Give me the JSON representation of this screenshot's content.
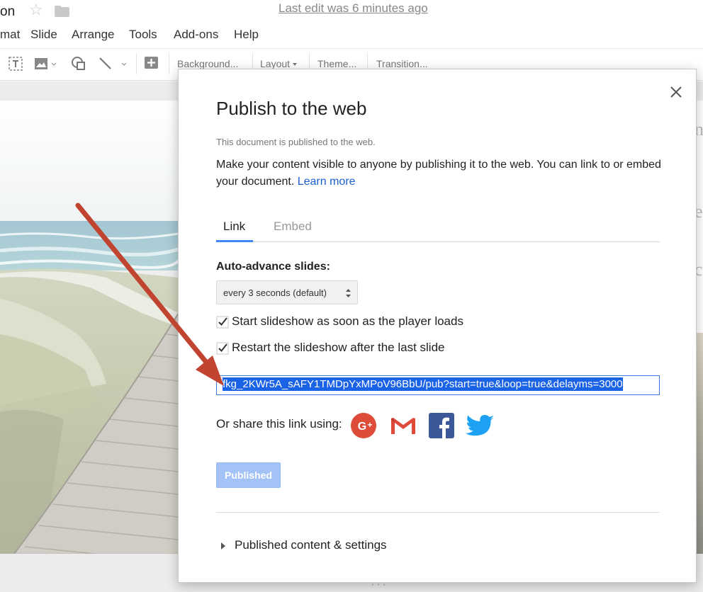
{
  "app": {
    "doc_title_fragment": "on",
    "menu": [
      "mat",
      "Slide",
      "Arrange",
      "Tools",
      "Add-ons",
      "Help"
    ],
    "last_edit": "Last edit was 6 minutes ago",
    "toolbar": {
      "background": "Background...",
      "layout": "Layout",
      "theme": "Theme...",
      "transition": "Transition..."
    },
    "icons": [
      "star-icon",
      "folder-icon",
      "text-box-icon",
      "image-icon",
      "shape-icon",
      "line-icon",
      "new-slide-icon"
    ]
  },
  "dialog": {
    "title": "Publish to the web",
    "status": "This document is published to the web.",
    "description": "Make your content visible to anyone by publishing it to the web. You can link to or embed your document.",
    "learn_more": "Learn more",
    "tabs": [
      {
        "label": "Link",
        "active": true
      },
      {
        "label": "Embed",
        "active": false
      }
    ],
    "auto_advance_label": "Auto-advance slides:",
    "auto_advance_value": "every 3 seconds (default)",
    "checkboxes": [
      {
        "label": "Start slideshow as soon as the player loads",
        "checked": true
      },
      {
        "label": "Restart the slideshow after the last slide",
        "checked": true
      }
    ],
    "url": "fkg_2KWr5A_sAFY1TMDpYxMPoV96BbU/pub?start=true&loop=true&delayms=3000",
    "share_label": "Or share this link using:",
    "share_services": [
      "Google+",
      "Gmail",
      "Facebook",
      "Twitter"
    ],
    "published_button": "Published",
    "expander_label": "Published content & settings"
  },
  "colors": {
    "accent_blue": "#4285f4",
    "link_blue": "#1a5fd1",
    "annotation_arrow": "#c0442f",
    "published_button": "#a3c3f7"
  }
}
